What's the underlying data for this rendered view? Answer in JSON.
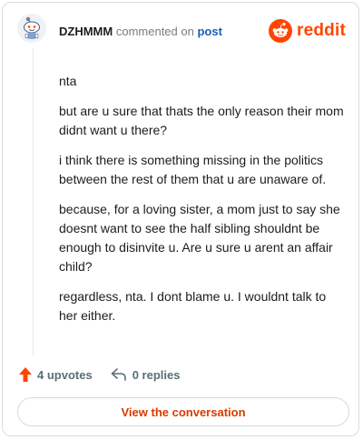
{
  "comment": {
    "username": "DZHMMM",
    "action_text": "commented on",
    "link_text": "post",
    "paragraphs": [
      "nta",
      "but are u sure that thats the only reason their mom didnt want u there?",
      "i think there is something missing in the politics between the rest of them that u are unaware of.",
      "because, for a loving sister, a mom just to say she doesnt want to see the half sibling shouldnt be enough to disinvite u. Are u sure u arent an affair child?",
      "regardless, nta. I dont blame u. I wouldnt talk to her either."
    ]
  },
  "brand": {
    "name": "reddit",
    "icon": "reddit-logo-icon",
    "color": "#ff4500"
  },
  "footer": {
    "upvotes_label": "4 upvotes",
    "replies_label": "0 replies",
    "upvote_icon": "upvote-arrow-icon",
    "reply_icon": "reply-arrow-icon",
    "upvote_color": "#ff4500"
  },
  "cta": {
    "label": "View the conversation",
    "color": "#d93a00"
  }
}
